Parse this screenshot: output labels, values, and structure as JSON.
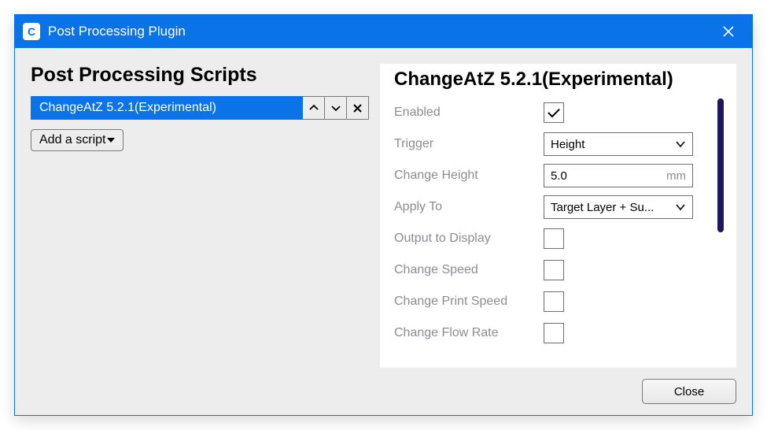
{
  "window": {
    "title": "Post Processing Plugin",
    "app_icon_letter": "C"
  },
  "left": {
    "heading": "Post Processing Scripts",
    "scripts": [
      {
        "name": "ChangeAtZ 5.2.1(Experimental)"
      }
    ],
    "add_label": "Add a script"
  },
  "right": {
    "heading": "ChangeAtZ 5.2.1(Experimental)",
    "fields": {
      "enabled": {
        "label": "Enabled",
        "checked": true
      },
      "trigger": {
        "label": "Trigger",
        "value": "Height"
      },
      "change_height": {
        "label": "Change Height",
        "value": "5.0",
        "unit": "mm"
      },
      "apply_to": {
        "label": "Apply To",
        "value": "Target Layer + Su..."
      },
      "output_to_display": {
        "label": "Output to Display",
        "checked": false
      },
      "change_speed": {
        "label": "Change Speed",
        "checked": false
      },
      "change_print_speed": {
        "label": "Change Print Speed",
        "checked": false
      },
      "change_flow_rate": {
        "label": "Change Flow Rate",
        "checked": false
      }
    }
  },
  "footer": {
    "close": "Close"
  }
}
